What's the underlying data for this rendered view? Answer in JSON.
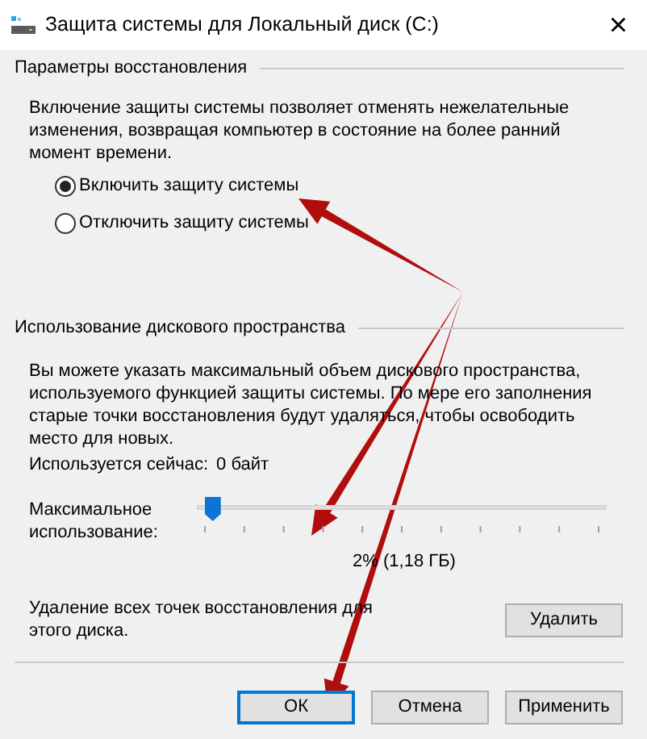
{
  "window": {
    "title": "Защита системы для Локальный диск (C:)",
    "close": "×"
  },
  "restore_settings": {
    "heading": "Параметры восстановления",
    "description": "Включение защиты системы позволяет отменять нежелательные изменения, возвращая компьютер в состояние на более ранний момент времени.",
    "options": [
      {
        "label": "Включить защиту системы",
        "selected": true
      },
      {
        "label": "Отключить защиту системы",
        "selected": false
      }
    ]
  },
  "disk_usage": {
    "heading": "Использование дискового пространства",
    "description": "Вы можете указать максимальный объем дискового пространства, используемого функцией защиты системы. По мере его заполнения старые точки восстановления будут удаляться, чтобы освободить место для новых.",
    "current_usage": {
      "label": "Используется сейчас:",
      "value": "0 байт"
    },
    "max_usage": {
      "label": "Максимальное использование:",
      "level": 0.02,
      "reading": "2% (1,18 ГБ)"
    },
    "delete_text": "Удаление всех точек восстановления для этого диска.",
    "delete_button": "Удалить"
  },
  "buttons": [
    {
      "label": "ОК",
      "default": true
    },
    {
      "label": "Отмена",
      "default": false
    },
    {
      "label": "Применить",
      "default": false
    }
  ]
}
